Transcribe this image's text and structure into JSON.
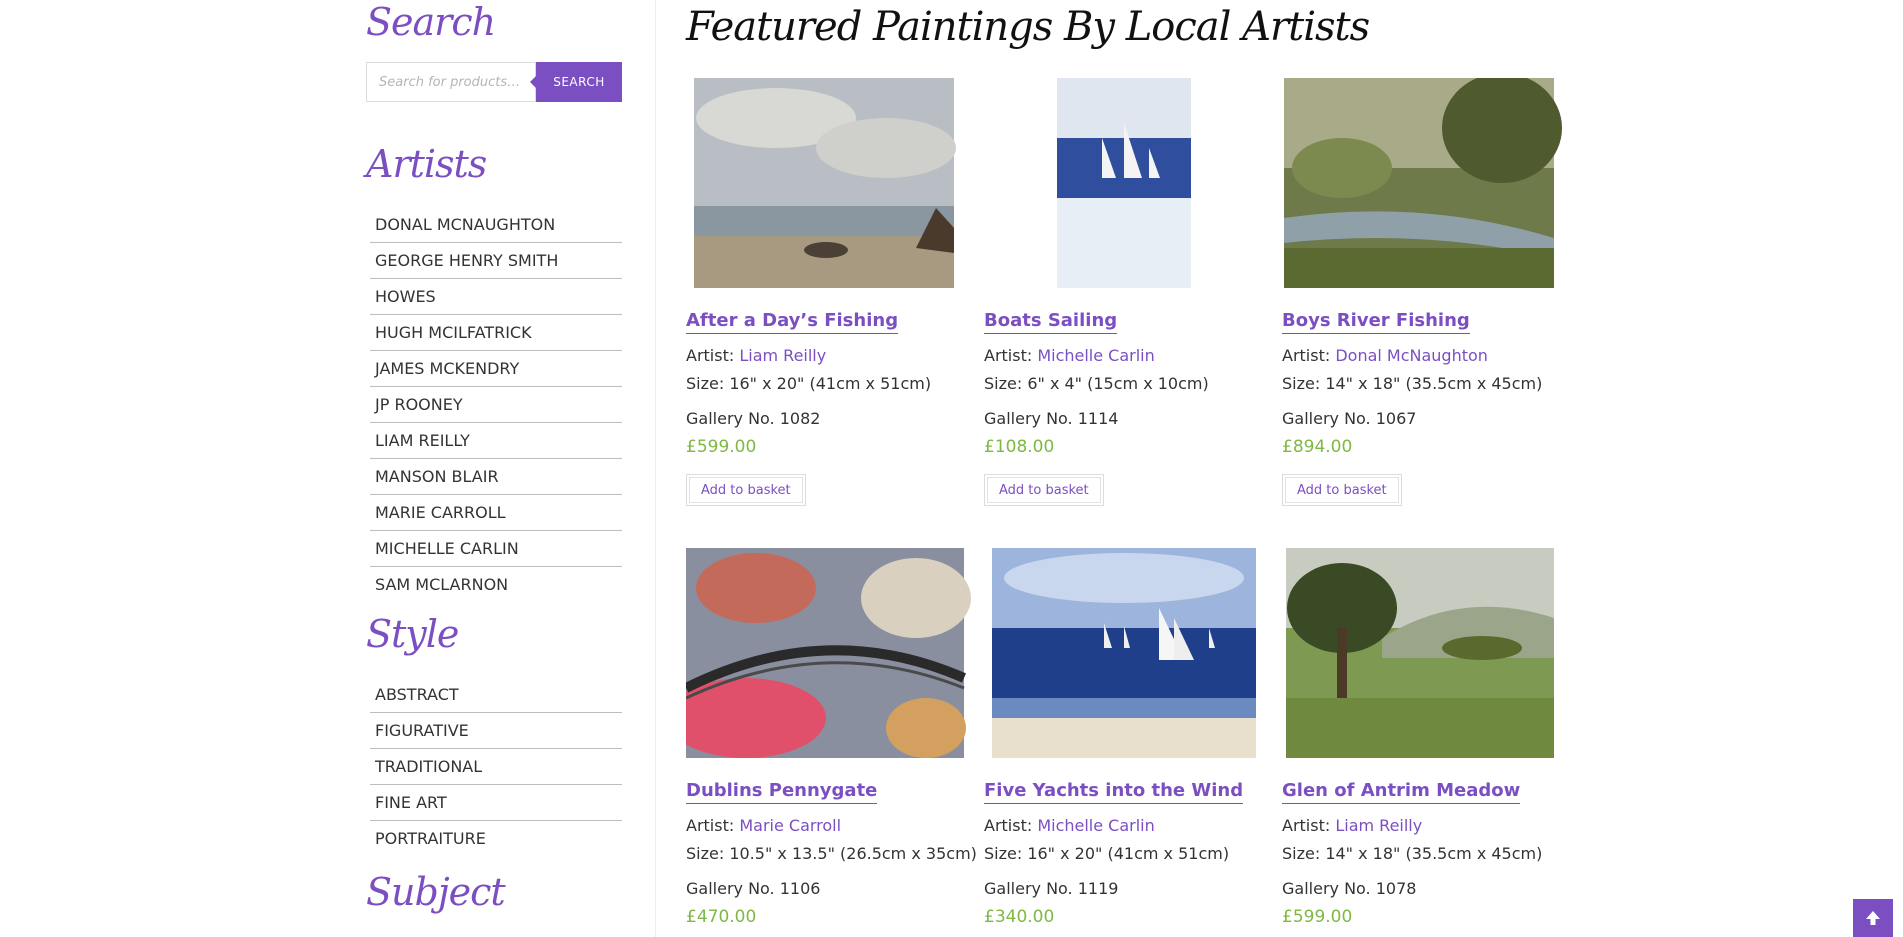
{
  "sidebar": {
    "search_title": "Search",
    "search_placeholder": "Search for products…",
    "search_button": "SEARCH",
    "artists_title": "Artists",
    "artists": [
      "DONAL MCNAUGHTON",
      "GEORGE HENRY SMITH",
      "HOWES",
      "HUGH MCILFATRICK",
      "JAMES MCKENDRY",
      "JP ROONEY",
      "LIAM REILLY",
      "MANSON BLAIR",
      "MARIE CARROLL",
      "MICHELLE CARLIN",
      "SAM MCLARNON"
    ],
    "style_title": "Style",
    "styles": [
      "ABSTRACT",
      "FIGURATIVE",
      "TRADITIONAL",
      "FINE ART",
      "PORTRAITURE"
    ],
    "subject_title": "Subject"
  },
  "main": {
    "title": "Featured Paintings By Local Artists",
    "artist_prefix": "Artist: ",
    "add_to_basket": "Add to basket",
    "products": [
      {
        "name": "After a Day’s Fishing",
        "artist": "Liam Reilly",
        "size": "Size: 16\" x 20\" (41cm x 51cm)",
        "gallery": "Gallery No. 1082",
        "price": "£599.00"
      },
      {
        "name": "Boats Sailing",
        "artist": "Michelle Carlin",
        "size": "Size: 6\" x 4\" (15cm x 10cm)",
        "gallery": "Gallery No. 1114",
        "price": "£108.00"
      },
      {
        "name": "Boys River Fishing",
        "artist": "Donal McNaughton",
        "size": "Size: 14\" x 18\" (35.5cm x 45cm)",
        "gallery": "Gallery No. 1067",
        "price": "£894.00"
      },
      {
        "name": "Dublins Pennygate",
        "artist": "Marie Carroll",
        "size": "Size: 10.5\" x 13.5\" (26.5cm x 35cm)",
        "gallery": "Gallery No. 1106",
        "price": "£470.00"
      },
      {
        "name": "Five Yachts into the Wind",
        "artist": "Michelle Carlin",
        "size": "Size: 16\" x 20\" (41cm x 51cm)",
        "gallery": "Gallery No. 1119",
        "price": "£340.00"
      },
      {
        "name": "Glen of Antrim Meadow",
        "artist": "Liam Reilly",
        "size": "Size: 14\" x 18\" (35.5cm x 45cm)",
        "gallery": "Gallery No. 1078",
        "price": "£599.00"
      }
    ]
  },
  "colors": {
    "accent": "#7b4fc2",
    "price": "#7fb843"
  },
  "icons": {
    "scroll_top": "arrow-up-icon"
  }
}
